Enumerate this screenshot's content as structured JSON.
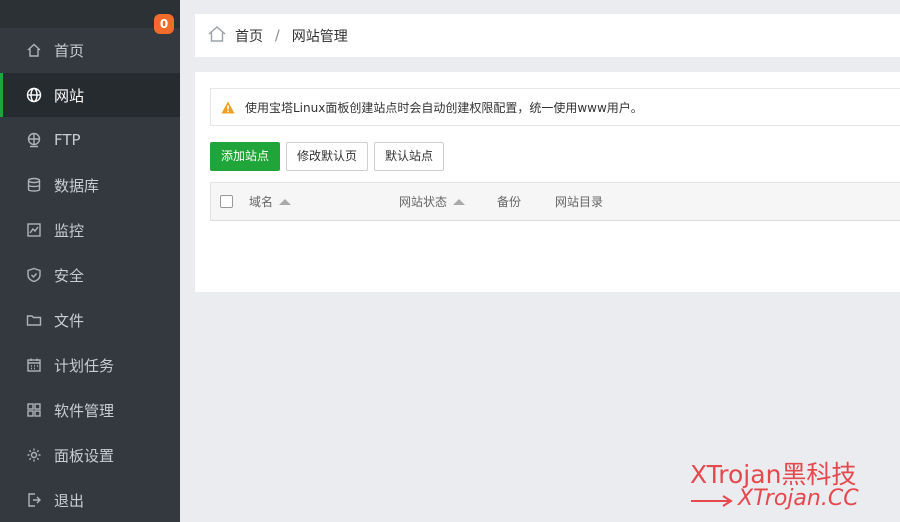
{
  "sidebar": {
    "badge": "0",
    "items": [
      {
        "label": "首页",
        "icon": "home-icon"
      },
      {
        "label": "网站",
        "icon": "globe-icon"
      },
      {
        "label": "FTP",
        "icon": "ftp-icon"
      },
      {
        "label": "数据库",
        "icon": "database-icon"
      },
      {
        "label": "监控",
        "icon": "monitor-icon"
      },
      {
        "label": "安全",
        "icon": "shield-icon"
      },
      {
        "label": "文件",
        "icon": "folder-icon"
      },
      {
        "label": "计划任务",
        "icon": "calendar-icon"
      },
      {
        "label": "软件管理",
        "icon": "apps-icon"
      },
      {
        "label": "面板设置",
        "icon": "gear-icon"
      },
      {
        "label": "退出",
        "icon": "logout-icon"
      }
    ]
  },
  "breadcrumb": {
    "home": "首页",
    "separator": "/",
    "current": "网站管理"
  },
  "notice": {
    "text": "使用宝塔Linux面板创建站点时会自动创建权限配置，统一使用www用户。"
  },
  "toolbar": {
    "add_site": "添加站点",
    "modify_default": "修改默认页",
    "default_site": "默认站点"
  },
  "table": {
    "columns": [
      "域名",
      "网站状态",
      "备份",
      "网站目录"
    ]
  },
  "watermark": {
    "title": "XTrojan黑科技",
    "url": "XTrojan.CC"
  },
  "colors": {
    "accent": "#20a53a",
    "sidebar": "#33393f",
    "badge": "#f26b2a",
    "watermark": "#e5484d"
  }
}
